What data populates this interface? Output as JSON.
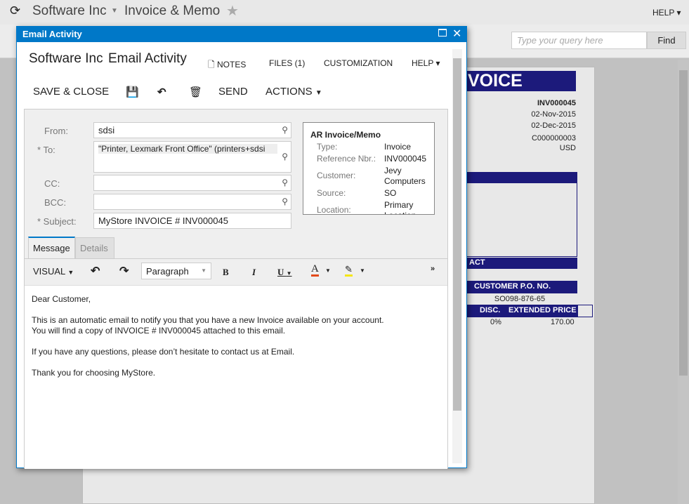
{
  "header": {
    "company": "Software Inc",
    "page": "Invoice & Memo",
    "help": "HELP"
  },
  "search": {
    "placeholder": "Type your query here",
    "find": "Find"
  },
  "invoice": {
    "title": "VOICE",
    "number": "INV000045",
    "date": "02-Nov-2015",
    "due_date": "02-Dec-2015",
    "customer_id": "C000000003",
    "currency": "USD",
    "contact_header": "ACT",
    "po_header": "CUSTOMER P.O. NO.",
    "po_value": "SO098-876-65",
    "disc_header": "DISC.",
    "ext_header": "EXTENDED PRICE",
    "disc_value": "0%",
    "ext_value": "170.00"
  },
  "dialog": {
    "title": "Email Activity",
    "company": "Software Inc",
    "screen": "Email Activity",
    "links": {
      "notes": "NOTES",
      "files": "FILES (1)",
      "customization": "CUSTOMIZATION",
      "help": "HELP"
    },
    "actions": {
      "save_close": "SAVE & CLOSE",
      "send": "SEND",
      "actions": "ACTIONS"
    },
    "form": {
      "from_label": "From:",
      "from": "sdsi",
      "to_label": "To:",
      "to": "\"Printer, Lexmark Front Office\" (printers+sdsi",
      "cc_label": "CC:",
      "bcc_label": "BCC:",
      "subject_label": "Subject:",
      "subject": "MyStore INVOICE # INV000045"
    },
    "summary": {
      "title": "AR Invoice/Memo",
      "rows": [
        {
          "k": "Type:",
          "v": "Invoice"
        },
        {
          "k": "Reference Nbr.:",
          "v": "INV000045"
        },
        {
          "k": "Customer:",
          "v": "Jevy Computers"
        },
        {
          "k": "Source:",
          "v": "SO"
        },
        {
          "k": "Location:",
          "v": "Primary Location"
        }
      ]
    },
    "tabs": [
      "Message",
      "Details"
    ],
    "editor": {
      "mode": "VISUAL",
      "format": "Paragraph",
      "lines": [
        "Dear Customer,",
        "This is an automatic email to notify you that you have a new Invoice available on your account.",
        "You will find a copy of INVOICE # INV000045 attached to this email.",
        "If you have any questions, please don’t hesitate to contact us at Email.",
        "Thank you for choosing MyStore."
      ]
    }
  },
  "colors": {
    "accent": "#0078c8",
    "invoice_navy": "#1c1a7b"
  }
}
